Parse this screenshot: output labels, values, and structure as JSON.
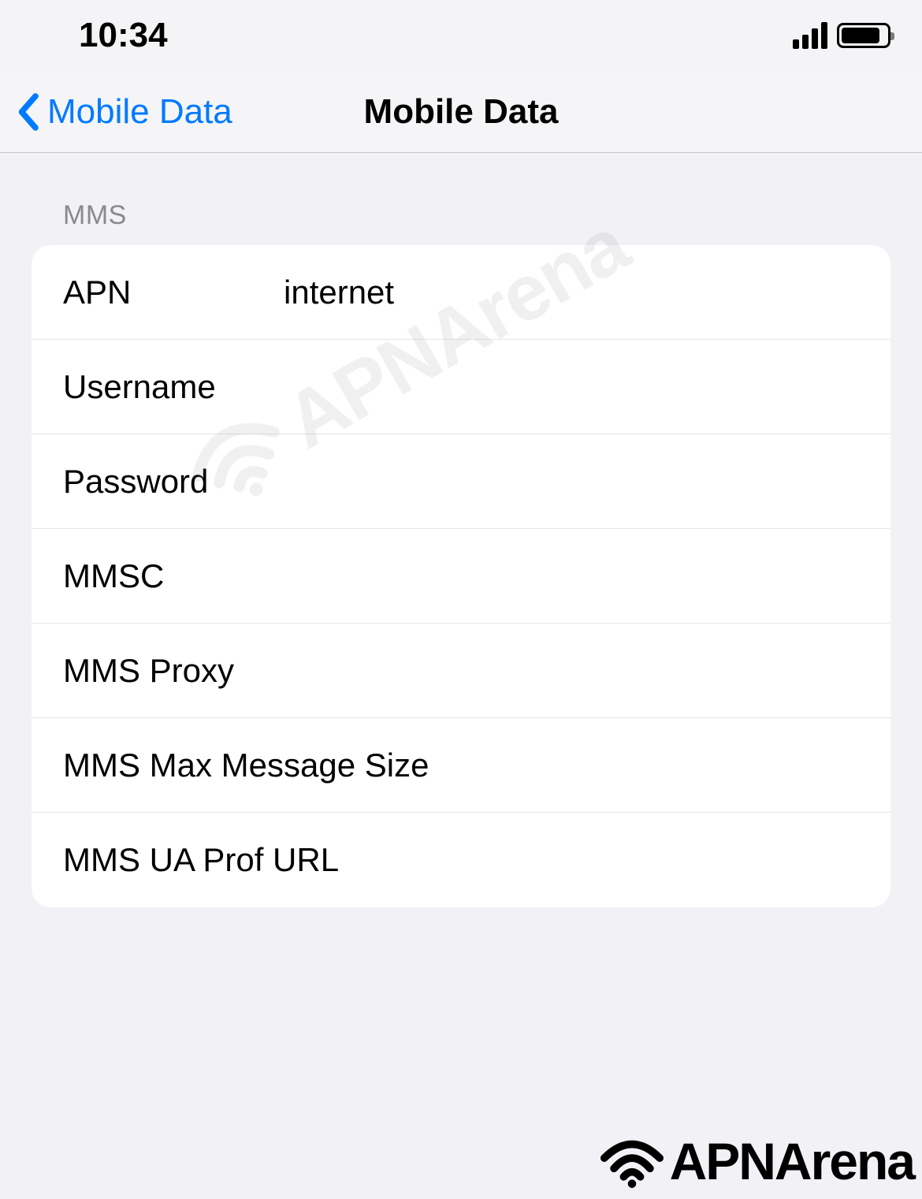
{
  "status_bar": {
    "time": "10:34"
  },
  "nav": {
    "back_label": "Mobile Data",
    "title": "Mobile Data"
  },
  "section": {
    "header": "MMS"
  },
  "fields": {
    "apn": {
      "label": "APN",
      "value": "internet"
    },
    "username": {
      "label": "Username",
      "value": ""
    },
    "password": {
      "label": "Password",
      "value": ""
    },
    "mmsc": {
      "label": "MMSC",
      "value": ""
    },
    "mms_proxy": {
      "label": "MMS Proxy",
      "value": ""
    },
    "mms_max_size": {
      "label": "MMS Max Message Size",
      "value": ""
    },
    "mms_ua_prof": {
      "label": "MMS UA Prof URL",
      "value": ""
    }
  },
  "watermark": {
    "text": "APNArena"
  }
}
